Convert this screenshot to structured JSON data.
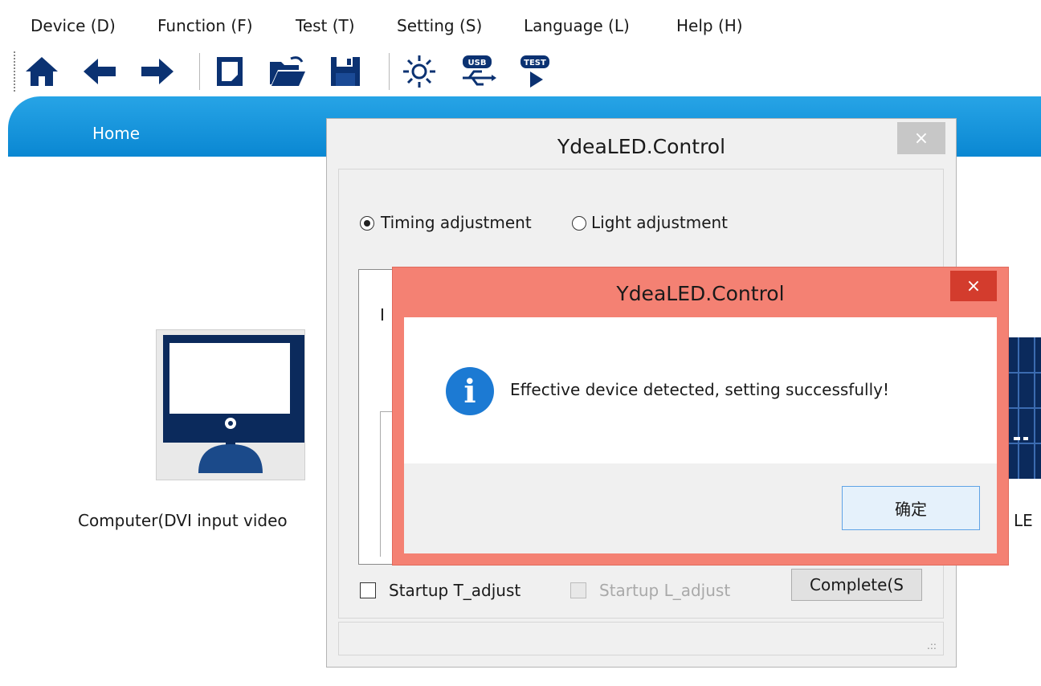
{
  "menu": {
    "items": [
      {
        "label": "Device (D)"
      },
      {
        "label": "Function (F)"
      },
      {
        "label": "Test (T)"
      },
      {
        "label": "Setting (S)"
      },
      {
        "label": "Language (L)"
      },
      {
        "label": "Help (H)"
      }
    ]
  },
  "toolbar": {
    "buttons": [
      {
        "icon": "home-icon"
      },
      {
        "icon": "arrow-left-icon"
      },
      {
        "icon": "arrow-right-icon"
      },
      {
        "icon": "new-file-icon"
      },
      {
        "icon": "open-folder-icon"
      },
      {
        "icon": "save-icon"
      },
      {
        "icon": "brightness-icon"
      },
      {
        "icon": "usb-icon",
        "text": "USB"
      },
      {
        "icon": "test-icon",
        "text": "TEST"
      }
    ]
  },
  "banner": {
    "home_tab": "Home"
  },
  "background": {
    "computer_label": "Computer(DVI input video",
    "led_label": "LE"
  },
  "dialog_timing": {
    "title": "YdeaLED.Control",
    "close": "×",
    "radio_timing": "Timing adjustment",
    "radio_light": "Light adjustment",
    "group_text": "I",
    "startup_t": "Startup T_adjust",
    "startup_l": "Startup L_adjust",
    "complete_button": "Complete(S",
    "resize_grip": ".::"
  },
  "dialog_message": {
    "title": "YdeaLED.Control",
    "close": "×",
    "icon": "i",
    "message": "Effective device detected, setting successfully!",
    "ok_button": "确定"
  },
  "colors": {
    "banner_blue": "#0a87d2",
    "msg_border": "#f48173",
    "msg_close": "#d33c2d",
    "info_blue": "#1c7ad3",
    "toolbar_icon": "#0b3272"
  }
}
